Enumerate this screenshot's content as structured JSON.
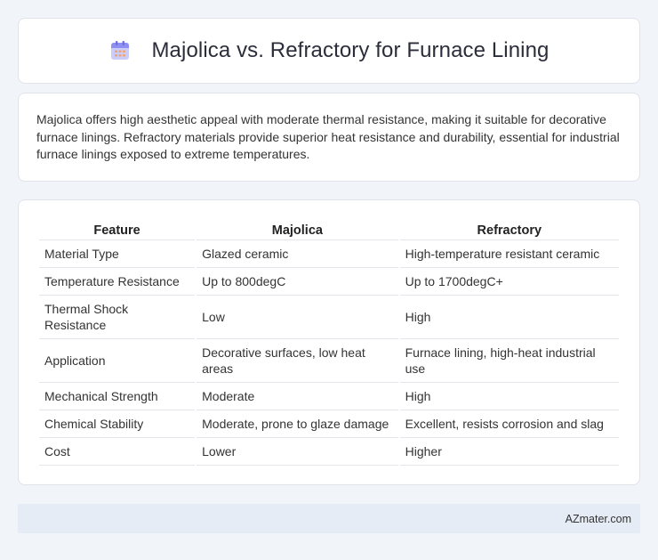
{
  "header": {
    "icon": "calendar-icon",
    "title": "Majolica vs. Refractory for Furnace Lining"
  },
  "summary": {
    "text": "Majolica offers high aesthetic appeal with moderate thermal resistance, making it suitable for decorative furnace linings. Refractory materials provide superior heat resistance and durability, essential for industrial furnace linings exposed to extreme temperatures."
  },
  "table": {
    "headers": [
      "Feature",
      "Majolica",
      "Refractory"
    ],
    "rows": [
      [
        "Material Type",
        "Glazed ceramic",
        "High-temperature resistant ceramic"
      ],
      [
        "Temperature Resistance",
        "Up to 800degC",
        "Up to 1700degC+"
      ],
      [
        "Thermal Shock Resistance",
        "Low",
        "High"
      ],
      [
        "Application",
        "Decorative surfaces, low heat areas",
        "Furnace lining, high-heat industrial use"
      ],
      [
        "Mechanical Strength",
        "Moderate",
        "High"
      ],
      [
        "Chemical Stability",
        "Moderate, prone to glaze damage",
        "Excellent, resists corrosion and slag"
      ],
      [
        "Cost",
        "Lower",
        "Higher"
      ]
    ]
  },
  "footer": {
    "brand": "AZmater.com"
  },
  "colors": {
    "background": "#f1f4f9",
    "card": "#ffffff",
    "footer": "#e6ecf6",
    "icon_accent": "#7b8cf0"
  }
}
